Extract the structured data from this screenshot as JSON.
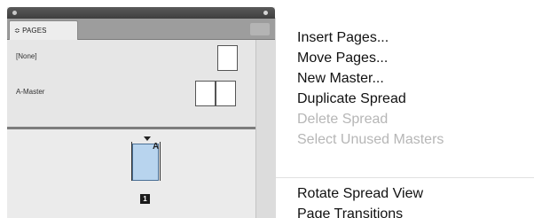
{
  "panel": {
    "tab_label": "≎ PAGES",
    "masters": [
      {
        "label": "[None]"
      },
      {
        "label": "A-Master"
      }
    ],
    "page_prefix": "A",
    "page_number": "1"
  },
  "menu": {
    "items": [
      {
        "label": "Insert Pages...",
        "enabled": true
      },
      {
        "label": "Move Pages...",
        "enabled": true
      },
      {
        "label": "New Master...",
        "enabled": true
      },
      {
        "label": "Duplicate Spread",
        "enabled": true
      },
      {
        "label": "Delete Spread",
        "enabled": false
      },
      {
        "label": "Select Unused Masters",
        "enabled": false
      },
      {
        "label": "Rotate Spread View",
        "enabled": true
      },
      {
        "label": "Page Transitions",
        "enabled": true
      }
    ]
  }
}
